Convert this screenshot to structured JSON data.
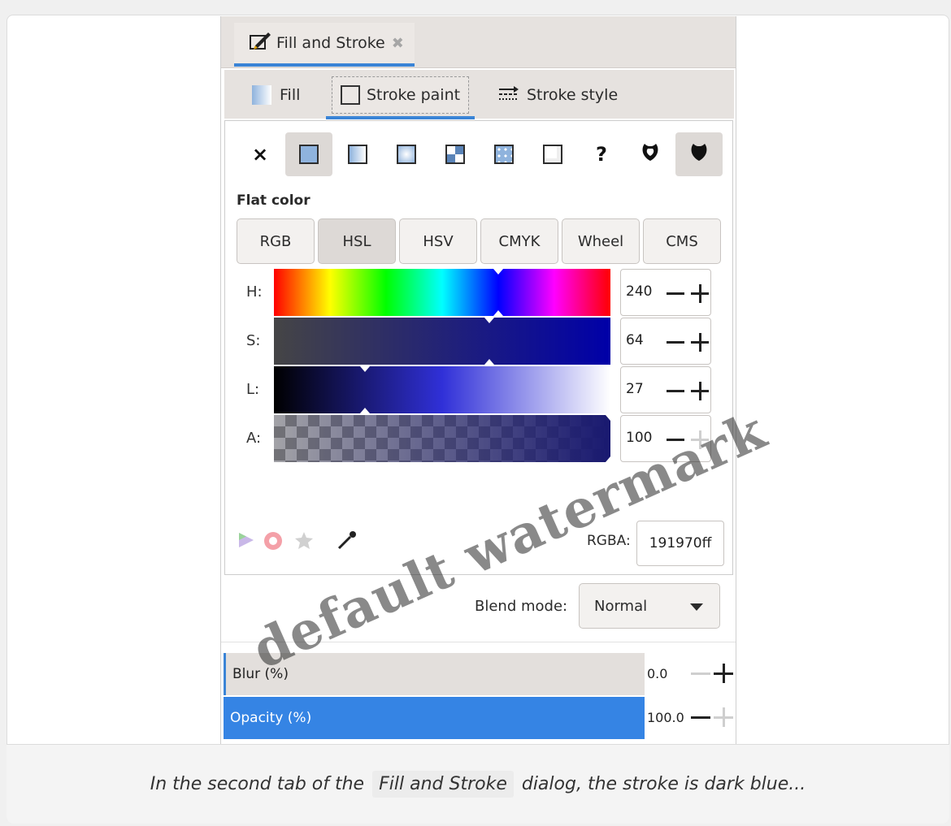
{
  "dialog_tab": {
    "title": "Fill and Stroke",
    "icon": "pen-fill-stroke-icon",
    "close_icon": "close-icon"
  },
  "subtabs": [
    {
      "label": "Fill",
      "icon": "fill-gradient-icon"
    },
    {
      "label": "Stroke paint",
      "icon": "stroke-paint-icon",
      "active": true
    },
    {
      "label": "Stroke style",
      "icon": "stroke-style-icon"
    }
  ],
  "paint_types": [
    {
      "name": "no-paint",
      "glyph": "×"
    },
    {
      "name": "flat-color",
      "active": true
    },
    {
      "name": "linear-gradient"
    },
    {
      "name": "radial-gradient"
    },
    {
      "name": "pattern"
    },
    {
      "name": "mesh"
    },
    {
      "name": "swatch"
    },
    {
      "name": "unset",
      "glyph": "?"
    },
    {
      "name": "fill-rule-evenodd"
    },
    {
      "name": "fill-rule-nonzero",
      "active": true
    }
  ],
  "flat_color_label": "Flat color",
  "color_modes": [
    "RGB",
    "HSL",
    "HSV",
    "CMYK",
    "Wheel",
    "CMS"
  ],
  "active_mode": "HSL",
  "sliders": [
    {
      "label": "H:",
      "value": "240",
      "fraction": 0.667
    },
    {
      "label": "S:",
      "value": "64",
      "fraction": 0.64
    },
    {
      "label": "L:",
      "value": "27",
      "fraction": 0.27
    },
    {
      "label": "A:",
      "value": "100",
      "fraction": 1.0
    }
  ],
  "rgba_label": "RGBA:",
  "rgba_value": "191970ff",
  "blend_label": "Blend mode:",
  "blend_value": "Normal",
  "blur": {
    "label": "Blur (%)",
    "value": "0.0"
  },
  "opacity": {
    "label": "Opacity (%)",
    "value": "100.0"
  },
  "caption": {
    "before": "In the second tab of the",
    "code": "Fill and Stroke",
    "after": "dialog, the stroke is dark blue..."
  },
  "watermark": "default watermark",
  "colors": {
    "accent": "#3a84d6",
    "stroke": "#191970"
  }
}
